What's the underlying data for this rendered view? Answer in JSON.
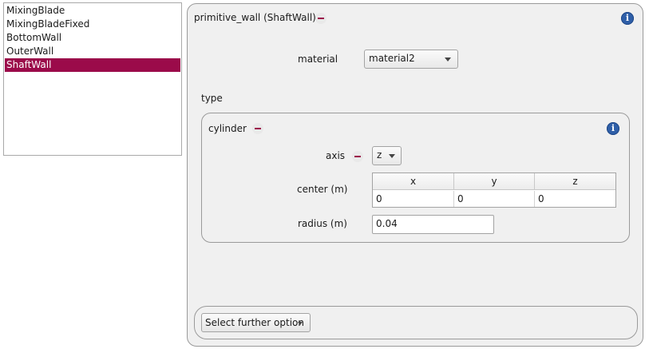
{
  "wall_list": {
    "items": [
      {
        "label": "MixingBlade"
      },
      {
        "label": "MixingBladeFixed"
      },
      {
        "label": "BottomWall"
      },
      {
        "label": "OuterWall"
      },
      {
        "label": "ShaftWall",
        "selected": true
      }
    ]
  },
  "panel": {
    "title": "primitive_wall (ShaftWall)",
    "material": {
      "label": "material",
      "value": "material2"
    },
    "type_label": "type"
  },
  "cylinder": {
    "title": "cylinder",
    "axis": {
      "label": "axis",
      "value": "z"
    },
    "center": {
      "label": "center (m)",
      "headers": [
        "x",
        "y",
        "z"
      ],
      "values": [
        "0",
        "0",
        "0"
      ]
    },
    "radius": {
      "label": "radius (m)",
      "value": "0.04"
    }
  },
  "further": {
    "button_label": "Select further option"
  },
  "colors": {
    "accent": "#9b0b4a",
    "info_icon": "#2f5fa8",
    "panel_bg": "#f0f0f0"
  },
  "icons": {
    "remove": "minus-icon",
    "info": "info-icon",
    "dropdown": "chevron-down-icon"
  }
}
